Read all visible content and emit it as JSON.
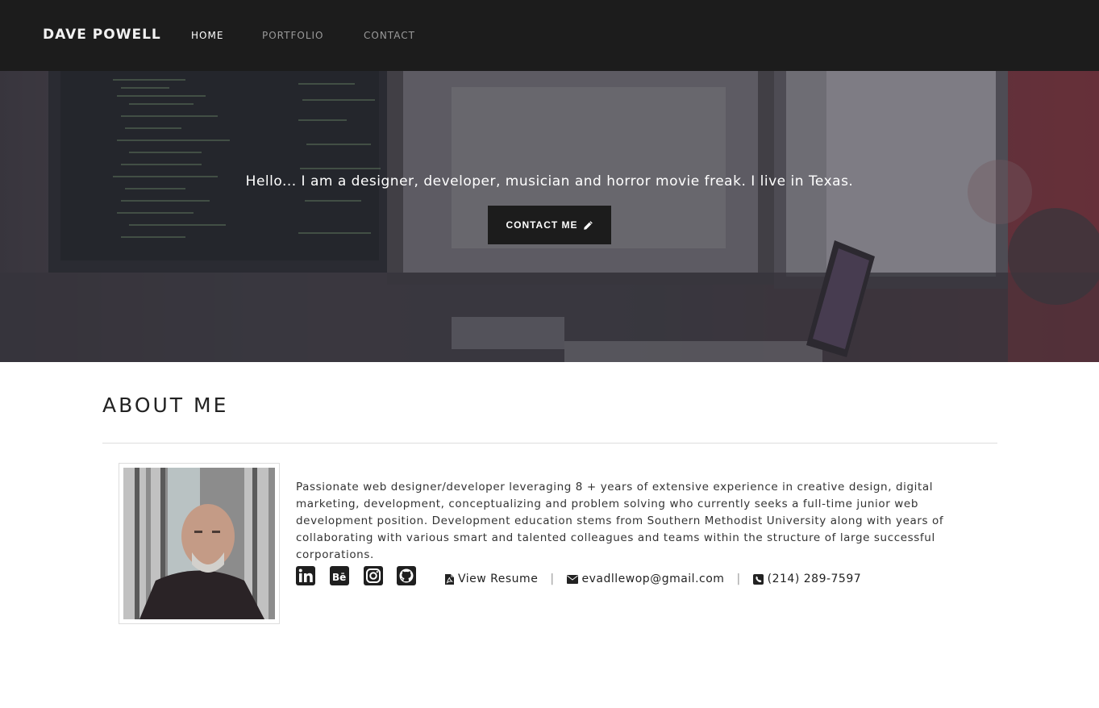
{
  "nav": {
    "brand": "DAVE POWELL",
    "links": [
      {
        "label": "HOME",
        "active": true
      },
      {
        "label": "PORTFOLIO",
        "active": false
      },
      {
        "label": "CONTACT",
        "active": false
      }
    ]
  },
  "hero": {
    "tagline": "Hello... I am a designer, developer, musician and horror movie freak. I live in Texas.",
    "button_label": "CONTACT ME",
    "button_icon": "pencil-icon"
  },
  "about": {
    "title": "ABOUT ME",
    "bio": "Passionate web designer/developer leveraging 8 + years of extensive experience in creative design, digital marketing, development, conceptualizing and problem solving who currently seeks a full-time junior web development position. Development education stems from Southern Methodist University along with years of collaborating with various smart and talented colleagues and teams within the structure of large successful corporations.",
    "social_icons": [
      "linkedin-icon",
      "behance-icon",
      "instagram-icon",
      "github-icon"
    ],
    "resume_label": "View Resume",
    "email": "evadllewop@gmail.com",
    "phone": "(214) 289-7597",
    "separator": "|"
  },
  "colors": {
    "navbar_bg": "#1c1c1c",
    "button_bg": "#1c1c1c",
    "text": "#222222"
  }
}
